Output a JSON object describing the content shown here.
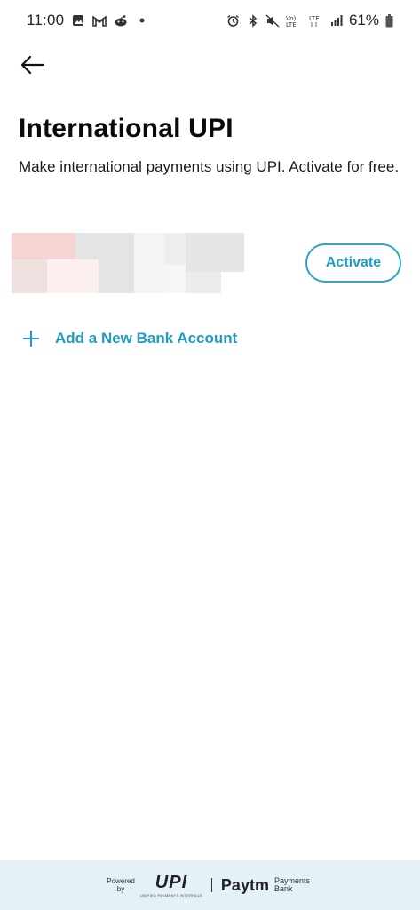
{
  "status_bar": {
    "time": "11:00",
    "battery": "61%",
    "network": "LTE",
    "volte": "Vo) LTE"
  },
  "header": {
    "back_label": "Back"
  },
  "page": {
    "title": "International UPI",
    "description": "Make international payments using UPI. Activate for free."
  },
  "bank_account": {
    "activate_label": "Activate"
  },
  "add_bank": {
    "label": "Add a New Bank Account"
  },
  "footer": {
    "powered_by": "Powered by",
    "upi": "UPI",
    "upi_sub": "UNIFIED PAYMENTS INTERFACE",
    "paytm": "Paytm",
    "payments_bank": "Payments Bank"
  },
  "colors": {
    "accent": "#1e9cc3",
    "footer_bg": "#e4f2f8"
  }
}
